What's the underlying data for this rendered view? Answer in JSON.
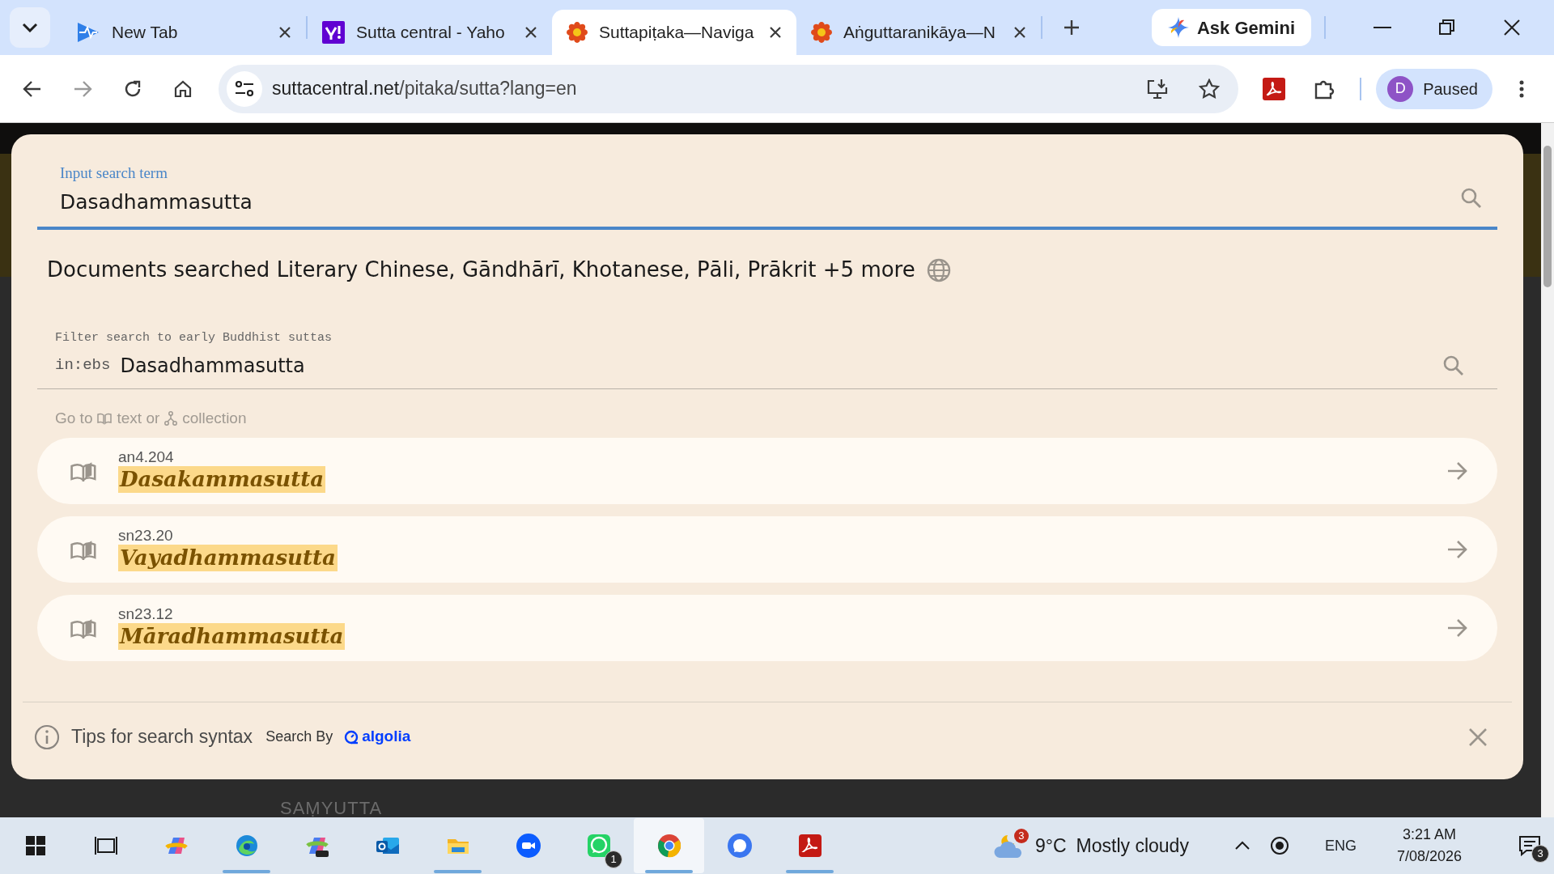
{
  "browser": {
    "tabs": [
      {
        "title": "New Tab",
        "kind": "pulse",
        "selected": false
      },
      {
        "title": "Sutta central - Yaho",
        "kind": "yahoo",
        "selected": false
      },
      {
        "title": "Suttapiṭaka—Naviga",
        "kind": "flower",
        "selected": true
      },
      {
        "title": "Aṅguttaranikāya—N",
        "kind": "flower",
        "selected": false
      }
    ],
    "ask_gemini": "Ask Gemini",
    "url": {
      "host": "suttacentral.net",
      "path": "/pitaka/sutta?lang=en"
    },
    "profile": {
      "initial": "D",
      "label": "Paused"
    }
  },
  "page_behind": {
    "section": "SAṂYUTTA"
  },
  "search": {
    "label": "Input search term",
    "value": "Dasadhammasutta",
    "focused": true
  },
  "documents": "Documents searched Literary Chinese, Gāndhārī, Khotanese, Pāli, Prākrit +5 more",
  "filter": {
    "label": "Filter search to early Buddhist suttas",
    "prefix": "in:ebs",
    "value": "Dasadhammasutta"
  },
  "goto": {
    "start": "Go to",
    "middle": "text or",
    "end": "collection"
  },
  "results": [
    {
      "code": "an4.204",
      "title": "Dasakammasutta"
    },
    {
      "code": "sn23.20",
      "title": "Vayadhammasutta"
    },
    {
      "code": "sn23.12",
      "title": "Māradhammasutta"
    }
  ],
  "footer": {
    "tips": "Tips for search syntax",
    "search_by": "Search By",
    "algolia": "algolia"
  },
  "taskbar": {
    "apps": [
      {
        "kind": "start",
        "active": false,
        "running": false
      },
      {
        "kind": "taskview",
        "active": false,
        "running": false
      },
      {
        "kind": "copilot",
        "active": false,
        "running": false
      },
      {
        "kind": "edge",
        "active": false,
        "running": true
      },
      {
        "kind": "m365",
        "active": false,
        "running": false
      },
      {
        "kind": "outlook",
        "active": false,
        "running": false
      },
      {
        "kind": "files",
        "active": false,
        "running": true
      },
      {
        "kind": "zoom",
        "active": false,
        "running": false
      },
      {
        "kind": "whatsapp",
        "active": false,
        "running": false,
        "badge": "1"
      },
      {
        "kind": "chrome",
        "active": true,
        "running": true
      },
      {
        "kind": "signal",
        "active": false,
        "running": false
      },
      {
        "kind": "acrobat",
        "active": false,
        "running": true
      }
    ],
    "weather": {
      "badge": "3",
      "temp": "9°C",
      "condition": "Mostly cloudy"
    },
    "language": "ENG",
    "time": "3:21 AM",
    "date": "7/08/2026",
    "notifications": "3"
  }
}
